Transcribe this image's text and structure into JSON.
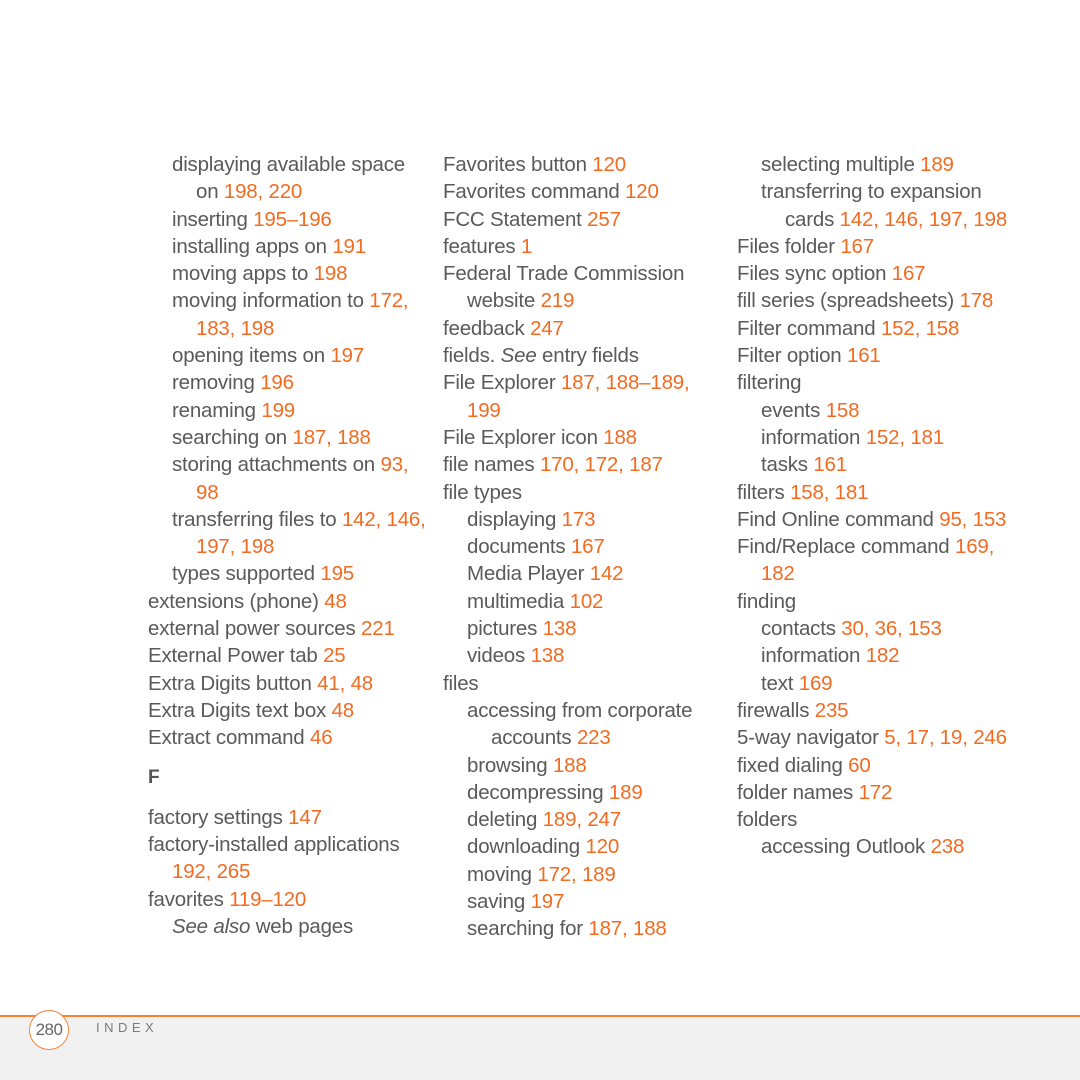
{
  "columns": [
    {
      "entries": [
        {
          "level": 1,
          "text": "displaying available space on",
          "pages": "198, 220"
        },
        {
          "level": 1,
          "text": "inserting",
          "pages": "195–196"
        },
        {
          "level": 1,
          "text": "installing apps on",
          "pages": "191"
        },
        {
          "level": 1,
          "text": "moving apps to",
          "pages": "198"
        },
        {
          "level": 1,
          "text": "moving information to",
          "pages": "172, 183, 198"
        },
        {
          "level": 1,
          "text": "opening items on",
          "pages": "197"
        },
        {
          "level": 1,
          "text": "removing",
          "pages": "196"
        },
        {
          "level": 1,
          "text": "renaming",
          "pages": "199"
        },
        {
          "level": 1,
          "text": "searching on",
          "pages": "187, 188"
        },
        {
          "level": 1,
          "text": "storing attachments on",
          "pages": "93, 98"
        },
        {
          "level": 1,
          "text": "transferring files to",
          "pages": "142, 146, 197, 198"
        },
        {
          "level": 1,
          "text": "types supported",
          "pages": "195"
        },
        {
          "level": 0,
          "text": "extensions (phone)",
          "pages": "48"
        },
        {
          "level": 0,
          "text": "external power sources",
          "pages": "221"
        },
        {
          "level": 0,
          "text": "External Power tab",
          "pages": "25"
        },
        {
          "level": 0,
          "text": "Extra Digits button",
          "pages": "41, 48"
        },
        {
          "level": 0,
          "text": "Extra Digits text box",
          "pages": "48"
        },
        {
          "level": 0,
          "text": "Extract command",
          "pages": "46"
        },
        {
          "type": "letter",
          "text": "F"
        },
        {
          "level": 0,
          "text": "factory settings",
          "pages": "147"
        },
        {
          "level": 0,
          "text": "factory-installed applications",
          "pages": "192, 265"
        },
        {
          "level": 0,
          "text": "favorites",
          "pages": "119–120"
        },
        {
          "level": 1,
          "italic": "See also",
          "text": "web pages",
          "pages": ""
        }
      ]
    },
    {
      "entries": [
        {
          "level": 0,
          "text": "Favorites button",
          "pages": "120"
        },
        {
          "level": 0,
          "text": "Favorites command",
          "pages": "120"
        },
        {
          "level": 0,
          "text": "FCC Statement",
          "pages": "257"
        },
        {
          "level": 0,
          "text": "features",
          "pages": "1"
        },
        {
          "level": 0,
          "text": "Federal Trade Commission website",
          "pages": "219"
        },
        {
          "level": 0,
          "text": "feedback",
          "pages": "247"
        },
        {
          "level": 0,
          "prefix": "fields.",
          "italic": "See",
          "text": "entry fields",
          "pages": ""
        },
        {
          "level": 0,
          "text": "File Explorer",
          "pages": "187, 188–189, 199"
        },
        {
          "level": 0,
          "text": "File Explorer icon",
          "pages": "188"
        },
        {
          "level": 0,
          "text": "file names",
          "pages": "170, 172, 187"
        },
        {
          "level": 0,
          "text": "file types",
          "pages": ""
        },
        {
          "level": 1,
          "text": "displaying",
          "pages": "173"
        },
        {
          "level": 1,
          "text": "documents",
          "pages": "167"
        },
        {
          "level": 1,
          "text": "Media Player",
          "pages": "142"
        },
        {
          "level": 1,
          "text": "multimedia",
          "pages": "102"
        },
        {
          "level": 1,
          "text": "pictures",
          "pages": "138"
        },
        {
          "level": 1,
          "text": "videos",
          "pages": "138"
        },
        {
          "level": 0,
          "text": "files",
          "pages": ""
        },
        {
          "level": 1,
          "text": "accessing from corporate accounts",
          "pages": "223"
        },
        {
          "level": 1,
          "text": "browsing",
          "pages": "188"
        },
        {
          "level": 1,
          "text": "decompressing",
          "pages": "189"
        },
        {
          "level": 1,
          "text": "deleting",
          "pages": "189, 247"
        },
        {
          "level": 1,
          "text": "downloading",
          "pages": "120"
        },
        {
          "level": 1,
          "text": "moving",
          "pages": "172, 189"
        },
        {
          "level": 1,
          "text": "saving",
          "pages": "197"
        },
        {
          "level": 1,
          "text": "searching for",
          "pages": "187, 188"
        }
      ]
    },
    {
      "entries": [
        {
          "level": 1,
          "text": "selecting multiple",
          "pages": "189"
        },
        {
          "level": 1,
          "text": "transferring to expansion cards",
          "pages": "142, 146, 197, 198"
        },
        {
          "level": 0,
          "text": "Files folder",
          "pages": "167"
        },
        {
          "level": 0,
          "text": "Files sync option",
          "pages": "167"
        },
        {
          "level": 0,
          "text": "fill series (spreadsheets)",
          "pages": "178"
        },
        {
          "level": 0,
          "text": "Filter command",
          "pages": "152, 158"
        },
        {
          "level": 0,
          "text": "Filter option",
          "pages": "161"
        },
        {
          "level": 0,
          "text": "filtering",
          "pages": ""
        },
        {
          "level": 1,
          "text": "events",
          "pages": "158"
        },
        {
          "level": 1,
          "text": "information",
          "pages": "152, 181"
        },
        {
          "level": 1,
          "text": "tasks",
          "pages": "161"
        },
        {
          "level": 0,
          "text": "filters",
          "pages": "158, 181"
        },
        {
          "level": 0,
          "text": "Find Online command",
          "pages": "95, 153"
        },
        {
          "level": 0,
          "text": "Find/Replace command",
          "pages": "169, 182"
        },
        {
          "level": 0,
          "text": "finding",
          "pages": ""
        },
        {
          "level": 1,
          "text": "contacts",
          "pages": "30, 36, 153"
        },
        {
          "level": 1,
          "text": "information",
          "pages": "182"
        },
        {
          "level": 1,
          "text": "text",
          "pages": "169"
        },
        {
          "level": 0,
          "text": "firewalls",
          "pages": "235"
        },
        {
          "level": 0,
          "text": "5-way navigator",
          "pages": "5, 17, 19, 246"
        },
        {
          "level": 0,
          "text": "fixed dialing",
          "pages": "60"
        },
        {
          "level": 0,
          "text": "folder names",
          "pages": "172"
        },
        {
          "level": 0,
          "text": "folders",
          "pages": ""
        },
        {
          "level": 1,
          "text": "accessing Outlook",
          "pages": "238"
        }
      ]
    }
  ],
  "footer": {
    "page_number": "280",
    "section": "INDEX"
  },
  "colors": {
    "accent": "#f26b21",
    "text": "#5a5a5a",
    "footer_band": "#f1f1f1"
  }
}
